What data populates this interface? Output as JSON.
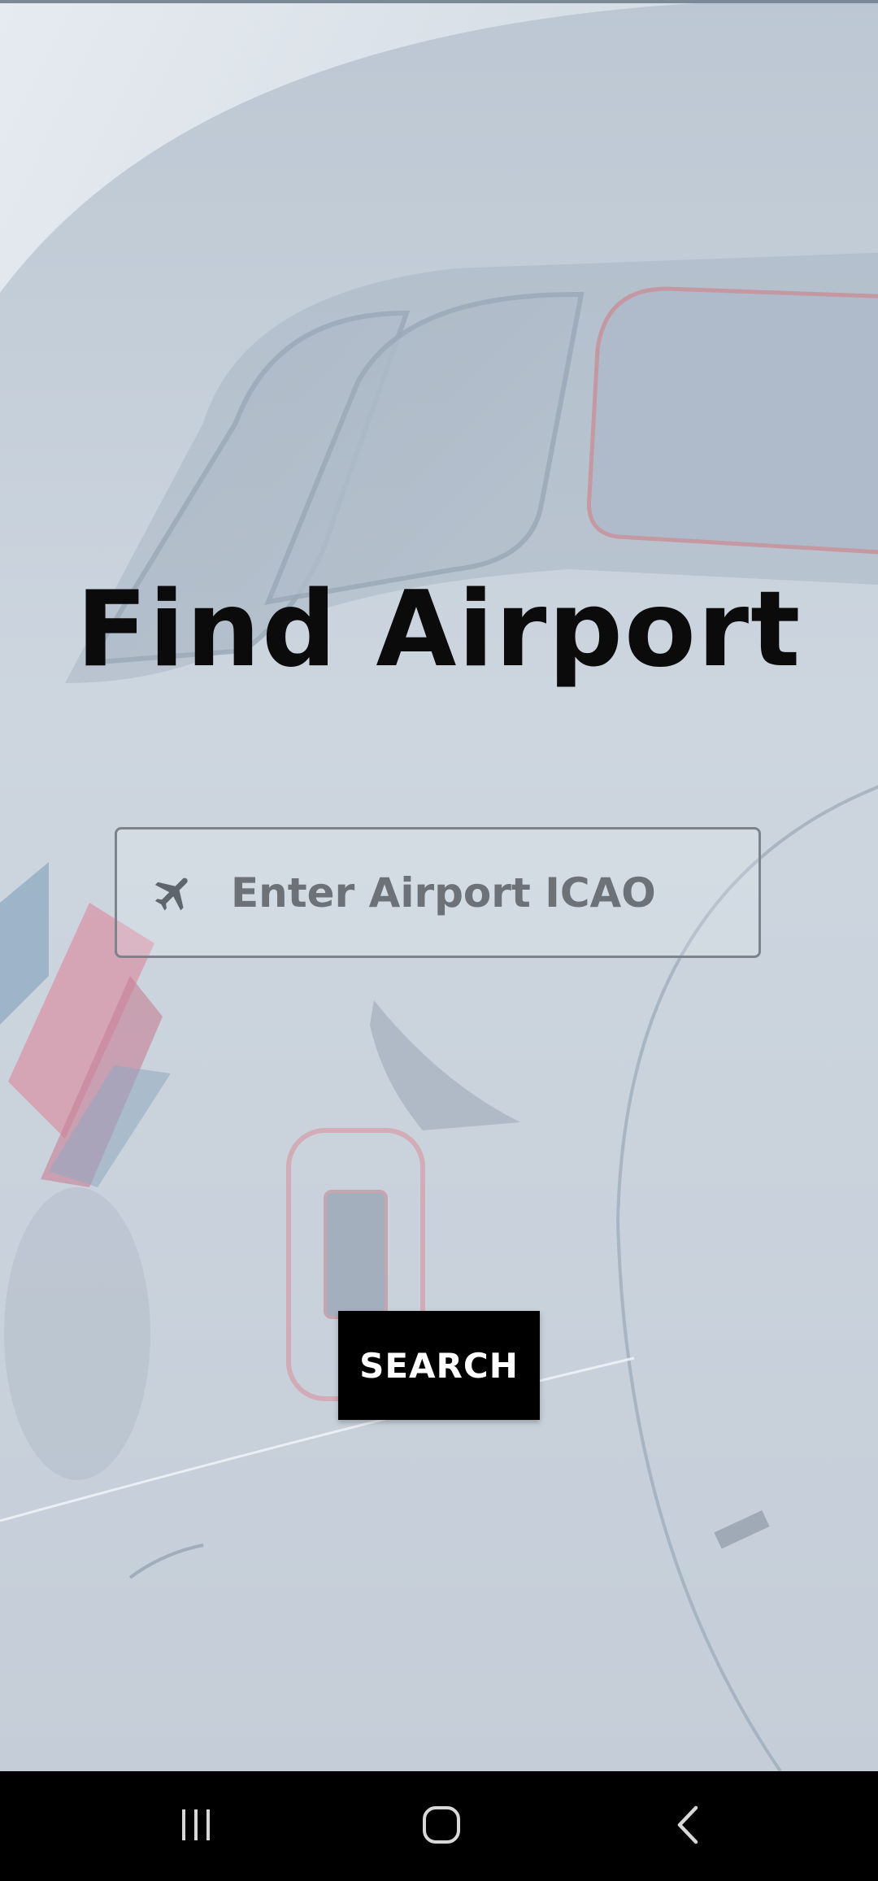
{
  "screen": {
    "title": "Find Airport"
  },
  "search": {
    "placeholder": "Enter Airport ICAO",
    "value": "",
    "icon": "airplane-icon"
  },
  "actions": {
    "search_label": "SEARCH"
  },
  "navbar": {
    "recent_icon": "recent-apps-icon",
    "home_icon": "home-icon",
    "back_icon": "back-icon"
  },
  "colors": {
    "title": "#0b0b0b",
    "button_bg": "#000000",
    "button_text": "#ffffff",
    "input_border": "#7d838a",
    "placeholder": "#6d7278",
    "navbar_bg": "#000000"
  }
}
